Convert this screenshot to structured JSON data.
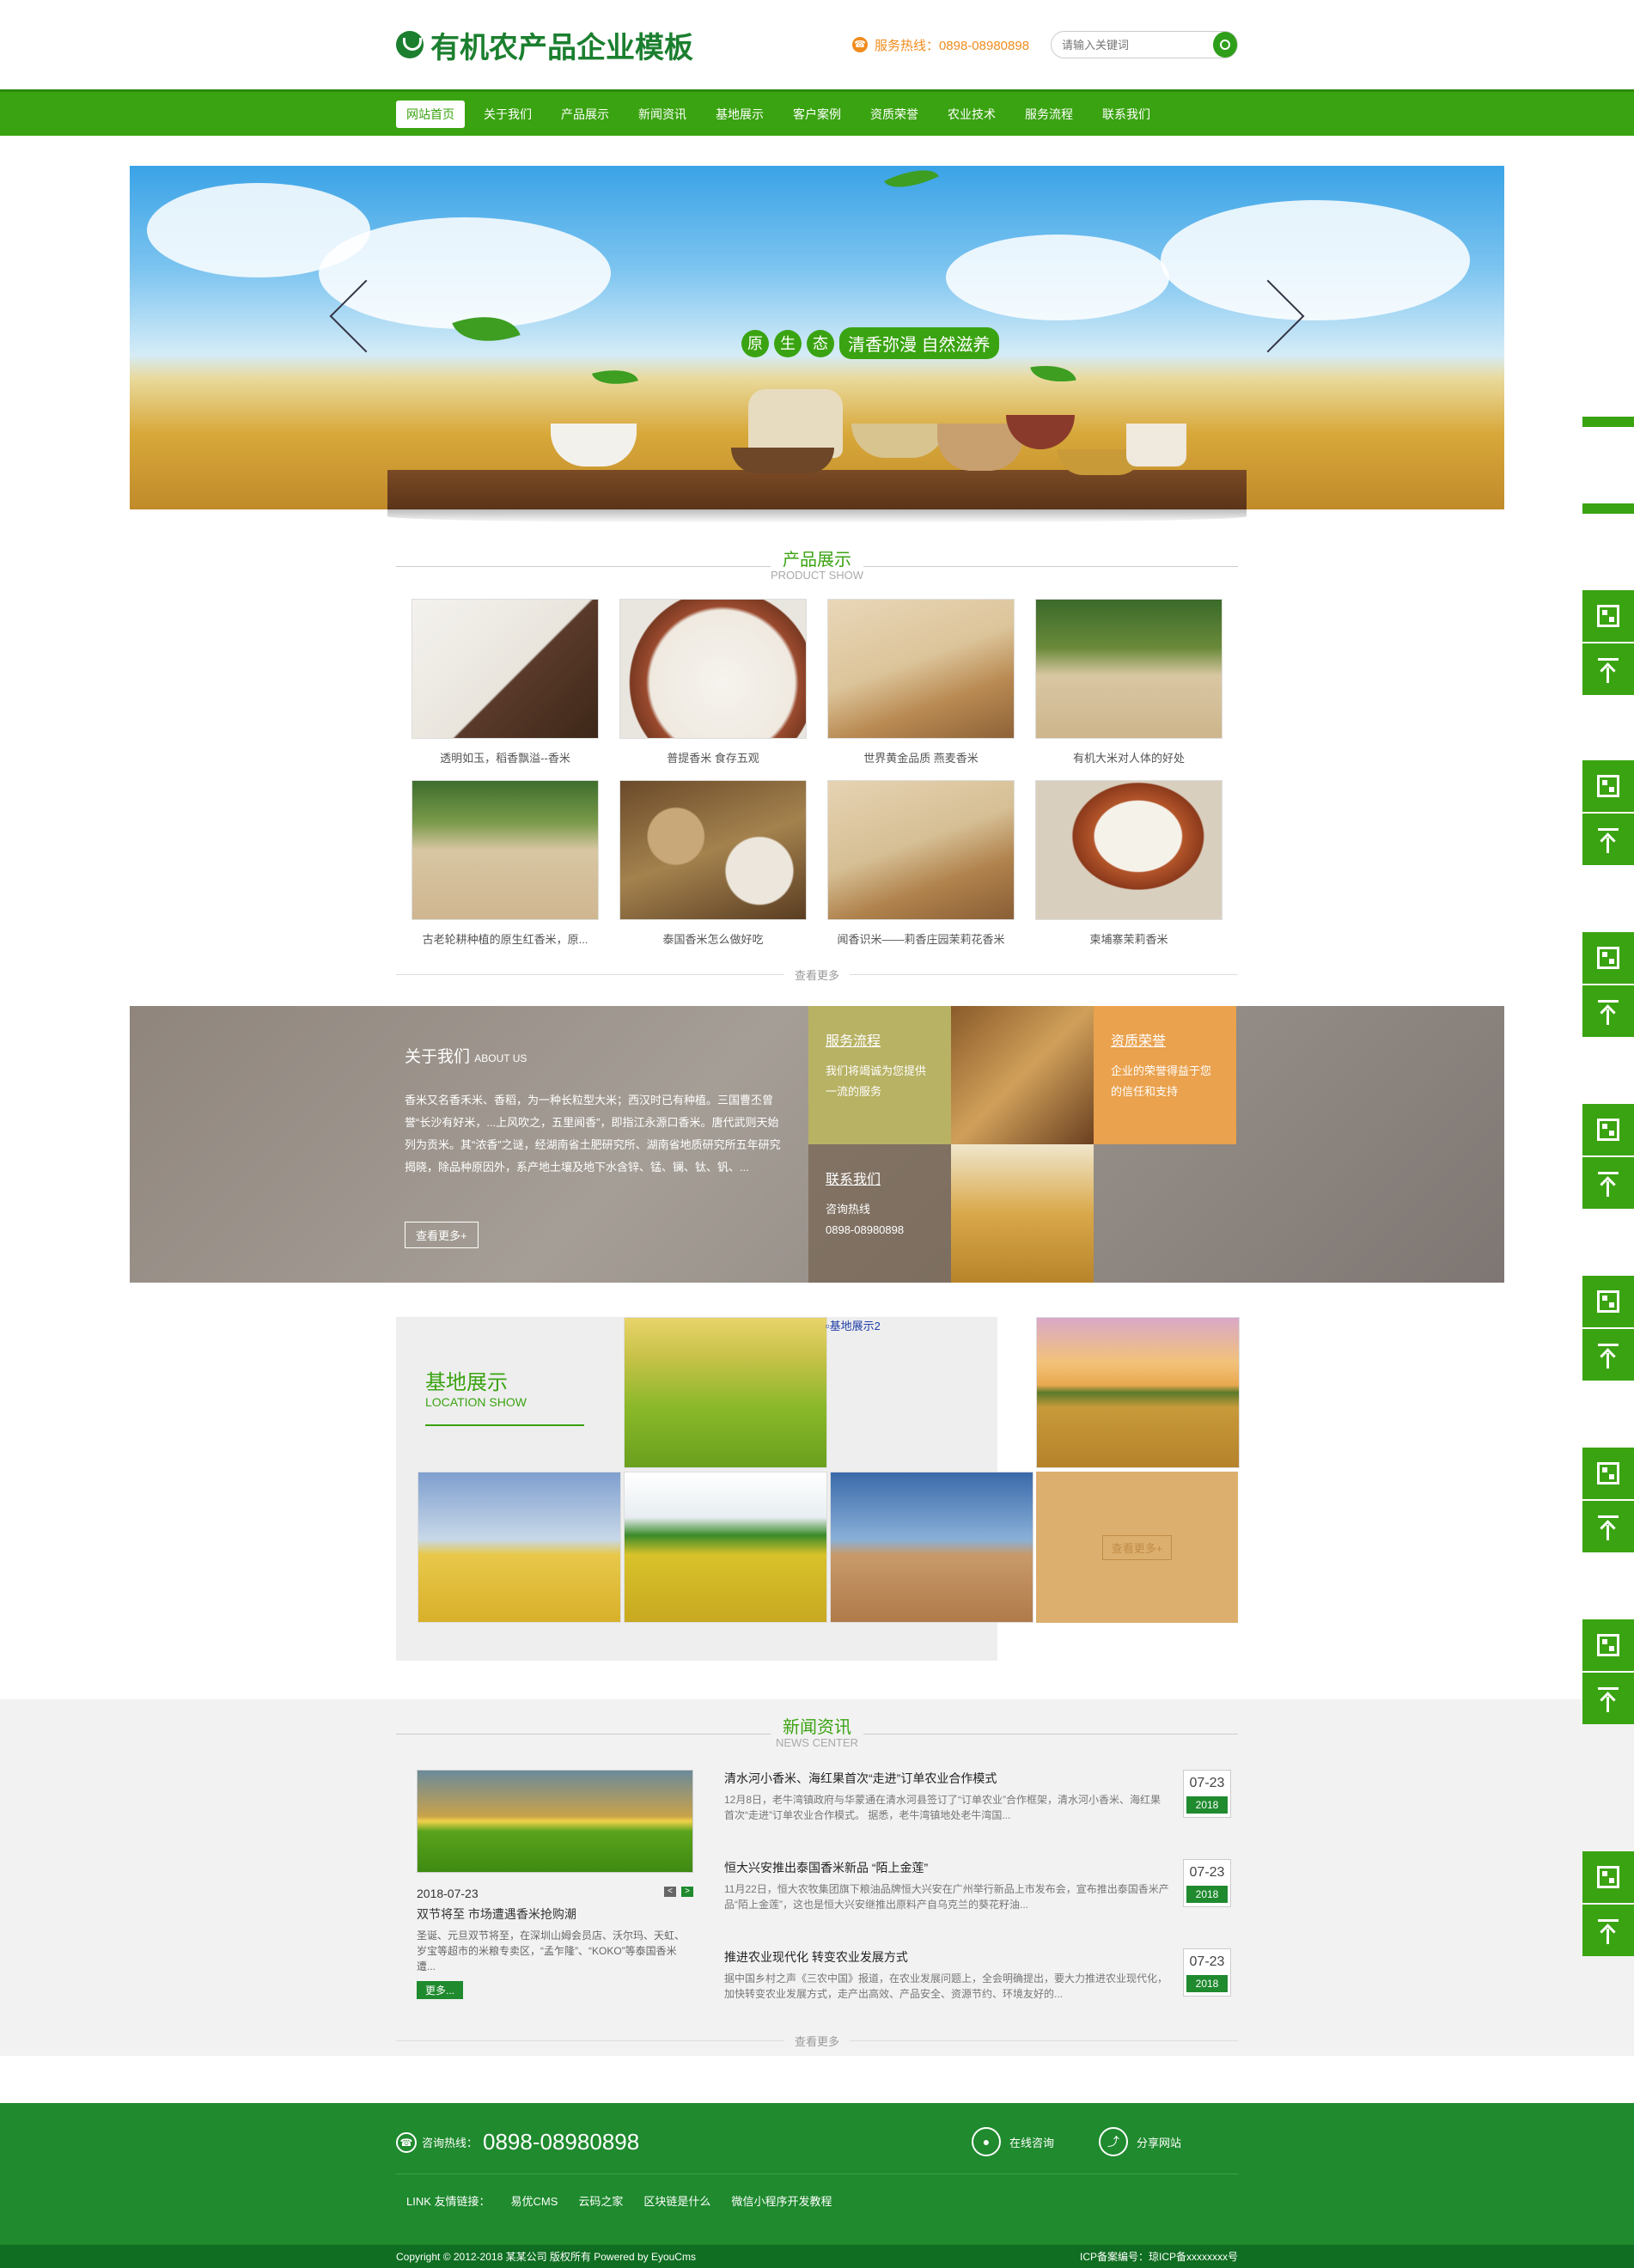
{
  "header": {
    "logo_text": "有机农产品企业模板",
    "hotline_label": "服务热线：0898-08980898",
    "search_placeholder": "请输入关键词"
  },
  "nav": {
    "items": [
      "网站首页",
      "关于我们",
      "产品展示",
      "新闻资讯",
      "基地展示",
      "客户案例",
      "资质荣誉",
      "农业技术",
      "服务流程",
      "联系我们"
    ]
  },
  "banner": {
    "slogan_chars": [
      "原",
      "生",
      "态"
    ],
    "slogan_text": "清香弥漫 自然滋养"
  },
  "products": {
    "title": "产品展示",
    "subtitle": "PRODUCT SHOW",
    "items": [
      "透明如玉，稻香飘溢--香米",
      "普提香米 食存五观",
      "世界黄金品质 燕麦香米",
      "有机大米对人体的好处",
      "古老轮耕种植的原生红香米，原...",
      "泰国香米怎么做好吃",
      "闻香识米——莉香庄园茉莉花香米",
      "柬埔寨茉莉香米"
    ],
    "more": "查看更多"
  },
  "about": {
    "title": "关于我们",
    "title_en": "ABOUT US",
    "body": "香米又名香禾米、香稻，为一种长粒型大米；西汉时已有种植。三国曹丕曾誉“长沙有好米，...上风吹之，五里闻香”，即指江永源口香米。唐代武则天始列为贡米。其“浓香”之谜，经湖南省土肥研究所、湖南省地质研究所五年研究揭晓，除品种原因外，系产地土壤及地下水含锌、锰、镧、钛、钒、...",
    "more": "查看更多+",
    "tiles": {
      "service_title": "服务流程",
      "service_text": "我们将竭诚为您提供一流的服务",
      "honor_title": "资质荣誉",
      "honor_text": "企业的荣誉得益于您的信任和支持",
      "contact_title": "联系我们",
      "contact_label": "咨询热线",
      "contact_phone": "0898-08980898"
    }
  },
  "base": {
    "title": "基地展示",
    "subtitle": "LOCATION SHOW",
    "broken_alt": "基地展示2",
    "more": "查看更多+"
  },
  "news": {
    "title": "新闻资讯",
    "subtitle": "NEWS CENTER",
    "featured": {
      "date": "2018-07-23",
      "title": "双节将至 市场遭遇香米抢购潮",
      "summary": "圣诞、元旦双节将至，在深圳山姆会员店、沃尔玛、天虹、岁宝等超市的米粮专卖区，“孟乍隆”、“KOKO”等泰国香米遭...",
      "more": "更多..."
    },
    "items": [
      {
        "title": "清水河小香米、海红果首次“走进”订单农业合作模式",
        "summary": "12月8日，老牛湾镇政府与华蒙通在清水河县签订了“订单农业”合作框架，清水河小香米、海红果首次“走进”订单农业合作模式。 据悉，老牛湾镇地处老牛湾国...",
        "date": "07-23",
        "year": "2018"
      },
      {
        "title": "恒大兴安推出泰国香米新品 “陌上金莲”",
        "summary": "11月22日，恒大农牧集团旗下粮油品牌恒大兴安在广州举行新品上市发布会，宣布推出泰国香米产品“陌上金莲”，这也是恒大兴安继推出原料产自乌克兰的葵花籽油...",
        "date": "07-23",
        "year": "2018"
      },
      {
        "title": "推进农业现代化 转变农业发展方式",
        "summary": "据中国乡村之声《三农中国》报道，在农业发展问题上，全会明确提出，要大力推进农业现代化，加快转变农业发展方式，走产出高效、产品安全、资源节约、环境友好的...",
        "date": "07-23",
        "year": "2018"
      }
    ],
    "more": "查看更多"
  },
  "footer": {
    "hotline_label": "咨询热线：",
    "hotline_number": "0898-08980898",
    "online_label": "在线咨询",
    "share_label": "分享网站",
    "links_label": "LINK 友情链接：",
    "links": [
      "易优CMS",
      "云码之家",
      "区块链是什么",
      "微信小程序开发教程"
    ],
    "copyright": "Copyright © 2012-2018 某某公司 版权所有 Powered by EyouCms",
    "icp": "ICP备案编号：琼ICP备xxxxxxxx号"
  },
  "colors": {
    "brand_green": "#3aa311",
    "dark_green": "#1f8a2e",
    "orange": "#f08c1e"
  }
}
